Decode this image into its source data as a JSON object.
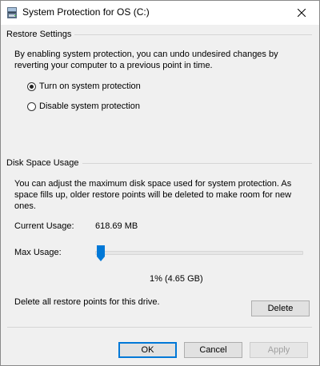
{
  "window": {
    "title": "System Protection for OS (C:)",
    "icon": "drive-icon"
  },
  "restore_settings": {
    "group_label": "Restore Settings",
    "description": "By enabling system protection, you can undo undesired changes by reverting your computer to a previous point in time.",
    "options": [
      {
        "label": "Turn on system protection",
        "selected": true
      },
      {
        "label": "Disable system protection",
        "selected": false
      }
    ]
  },
  "disk_space": {
    "group_label": "Disk Space Usage",
    "description": "You can adjust the maximum disk space used for system protection. As space fills up, older restore points will be deleted to make room for new ones.",
    "current_usage_label": "Current Usage:",
    "current_usage_value": "618.69 MB",
    "max_usage_label": "Max Usage:",
    "max_usage_fraction": 0.01,
    "max_usage_value": "1% (4.65 GB)",
    "delete_text": "Delete all restore points for this drive.",
    "delete_button": "Delete"
  },
  "footer": {
    "ok": "OK",
    "cancel": "Cancel",
    "apply": "Apply"
  },
  "colors": {
    "accent": "#0078d7",
    "window_bg": "#f0f0f0"
  }
}
